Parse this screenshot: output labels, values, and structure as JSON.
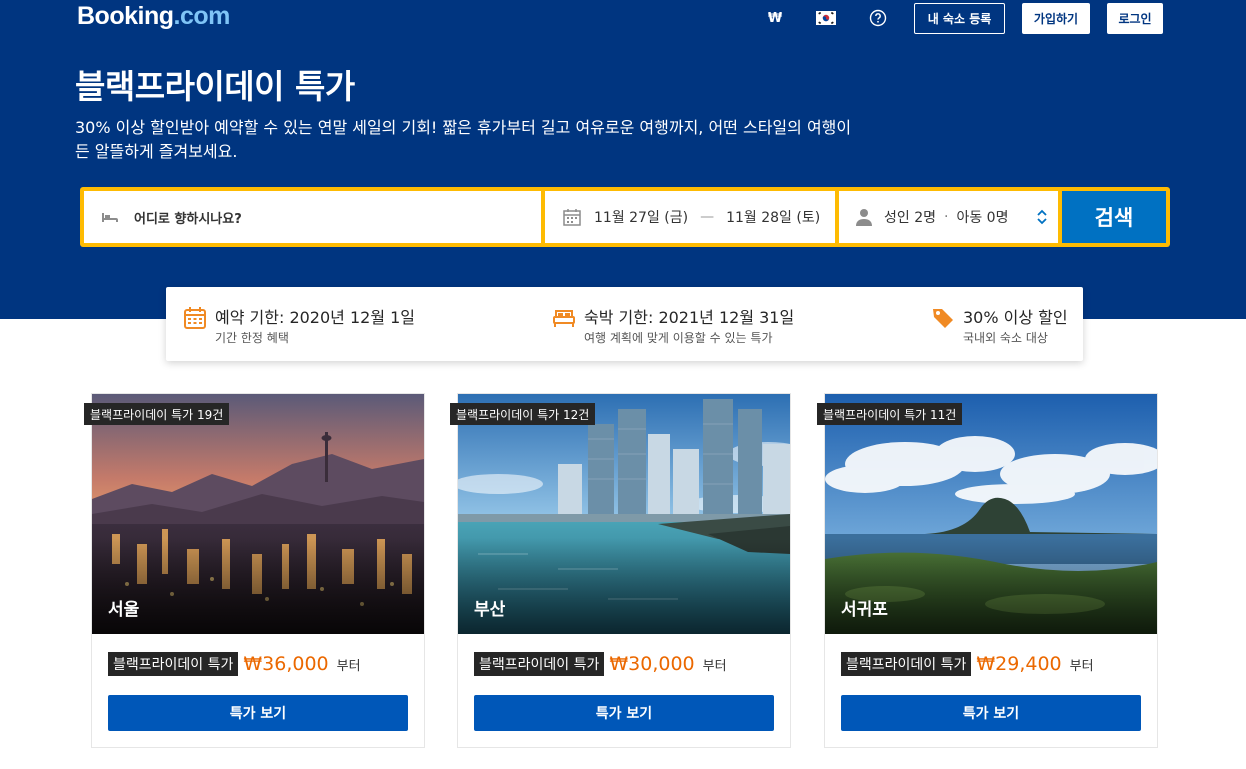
{
  "header": {
    "logo_main": "Booking",
    "logo_dot": ".com",
    "currency": "₩",
    "list_property": "내 숙소 등록",
    "signup": "가입하기",
    "login": "로그인"
  },
  "hero": {
    "title": "블랙프라이데이 특가",
    "subtitle": "30% 이상 할인받아 예약할 수 있는 연말 세일의 기회! 짧은 휴가부터 길고 여유로운 여행까지, 어떤 스타일의 여행이든 알뜰하게 즐겨보세요."
  },
  "search": {
    "destination_placeholder": "어디로 향하시나요?",
    "checkin": "11월 27일 (금)",
    "dash": "—",
    "checkout": "11월 28일 (토)",
    "adults": "성인 2명",
    "dot": "·",
    "children": "아동 0명",
    "button": "검색"
  },
  "info": [
    {
      "main": "예약 기한: 2020년 12월 1일",
      "sub": "기간 한정 혜택",
      "icon": "calendar-icon"
    },
    {
      "main": "숙박 기한: 2021년 12월 31일",
      "sub": "여행 계획에 맞게 이용할 수 있는 특가",
      "icon": "bed-icon"
    },
    {
      "main": "30% 이상 할인",
      "sub": "국내외 숙소 대상",
      "icon": "tag-icon"
    }
  ],
  "cards": [
    {
      "badge": "블랙프라이데이 특가 19건",
      "city": "서울",
      "deal_label": "블랙프라이데이 특가",
      "price": "₩36,000",
      "from": "부터",
      "button": "특가 보기"
    },
    {
      "badge": "블랙프라이데이 특가 12건",
      "city": "부산",
      "deal_label": "블랙프라이데이 특가",
      "price": "₩30,000",
      "from": "부터",
      "button": "특가 보기"
    },
    {
      "badge": "블랙프라이데이 특가 11건",
      "city": "서귀포",
      "deal_label": "블랙프라이데이 특가",
      "price": "₩29,400",
      "from": "부터",
      "button": "특가 보기"
    }
  ],
  "colors": {
    "brand_blue": "#003580",
    "search_yellow": "#febb02",
    "button_blue": "#0071c2",
    "price_orange": "#eb6800",
    "icon_orange": "#f08a24"
  }
}
